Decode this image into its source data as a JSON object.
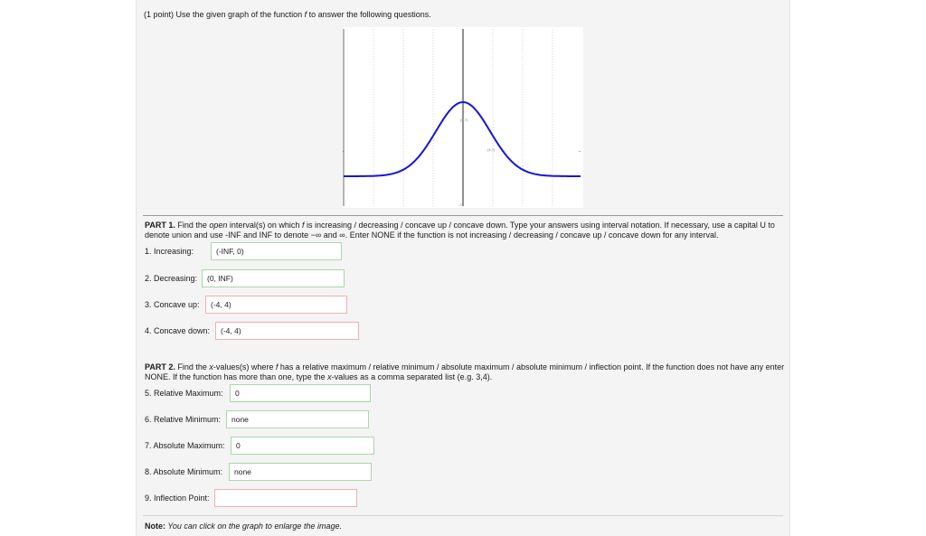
{
  "intro": {
    "pre": "(1 point) Use the given graph of the function ",
    "fn": "f",
    "post": " to answer the following questions."
  },
  "graph": {
    "peak_label": "(0,?)",
    "inflection_label": "(4,?)",
    "x_left_label": "-",
    "x_right_label": "-",
    "y_bottom_label": "-?"
  },
  "part1": {
    "heading": "PART 1.",
    "t1": " Find the ",
    "t2": "open",
    "t3": " interval(s) on which ",
    "fn": "f",
    "t4": " is increasing / decreasing / concave up / concave down. Type your answers using interval notation. If necessary, use a capital U to denote union and use -INF and INF to denote −∞ and ∞. Enter NONE if the function is not increasing / decreasing / concave up / concave down for any interval.",
    "questions": [
      {
        "label": "1. Increasing:",
        "value": "(-INF, 0)",
        "status": "correct"
      },
      {
        "label": "2. Decreasing:",
        "value": "(0, INF)",
        "status": "correct"
      },
      {
        "label": "3. Concave up:",
        "value": "(-4, 4)",
        "status": "incorrect"
      },
      {
        "label": "4. Concave down:",
        "value": "(-4, 4)",
        "status": "incorrect"
      }
    ]
  },
  "part2": {
    "heading": "PART 2.",
    "t1": " Find the ",
    "xv": "x",
    "t2": "-values(s) where ",
    "fn": "f",
    "t3": " has a relative maximum / relative minimum / absolute maximum / absolute minimum / inflection point. If the function does not have any enter NONE. If the function has more than one, type the ",
    "xv2": "x",
    "t4": "-values as a comma separated list (e.g. 3,4).",
    "questions": [
      {
        "label": "5. Relative Maximum:",
        "value": "0",
        "status": "correct"
      },
      {
        "label": "6. Relative Minimum:",
        "value": "none",
        "status": "correct"
      },
      {
        "label": "7. Absolute Maximum:",
        "value": "0",
        "status": "correct"
      },
      {
        "label": "8. Absolute Minimum:",
        "value": "none",
        "status": "correct"
      },
      {
        "label": "9. Inflection Point:",
        "value": "",
        "status": "incorrect"
      }
    ]
  },
  "note": {
    "label": "Note:",
    "text": " You can click on the graph to enlarge the image."
  },
  "colors": {
    "curve": "#1414e0",
    "correct_border": "#a8d8a8",
    "incorrect_border": "#efb0b0"
  }
}
